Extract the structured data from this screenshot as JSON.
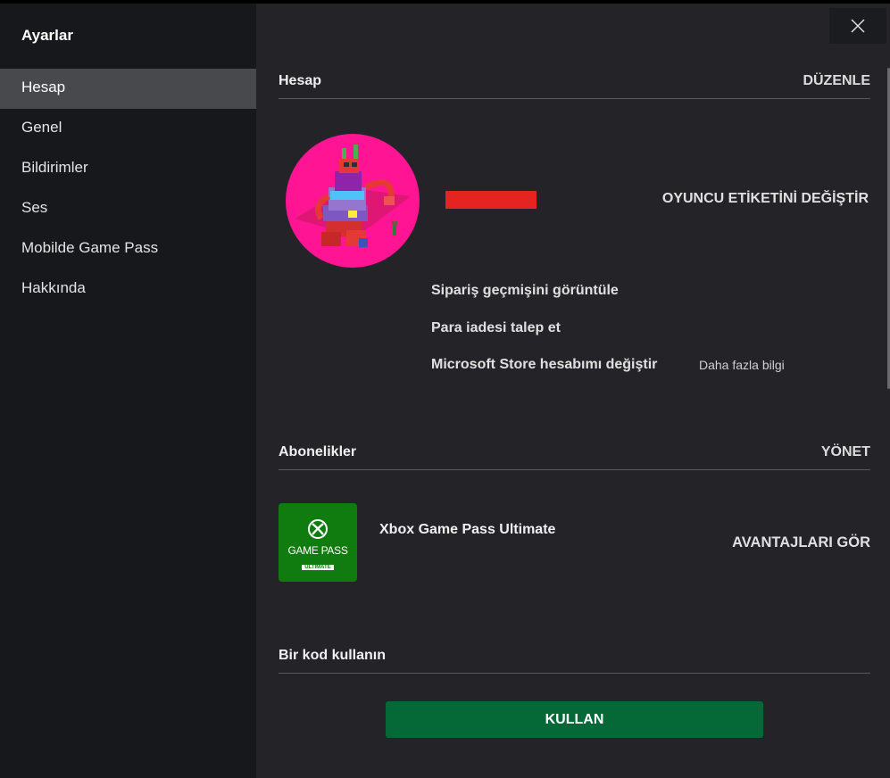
{
  "sidebar": {
    "title": "Ayarlar",
    "items": [
      {
        "label": "Hesap",
        "active": true
      },
      {
        "label": "Genel",
        "active": false
      },
      {
        "label": "Bildirimler",
        "active": false
      },
      {
        "label": "Ses",
        "active": false
      },
      {
        "label": "Mobilde Game Pass",
        "active": false
      },
      {
        "label": "Hakkında",
        "active": false
      }
    ]
  },
  "account": {
    "title": "Hesap",
    "edit_label": "DÜZENLE",
    "change_gamertag_label": "OYUNCU ETİKETİNİ DEĞİŞTİR",
    "links": {
      "order_history": "Sipariş geçmişini görüntüle",
      "refund": "Para iadesi talep et",
      "change_store_account": "Microsoft Store hesabımı değiştir",
      "more_info": "Daha fazla bilgi"
    }
  },
  "subscriptions": {
    "title": "Abonelikler",
    "manage_label": "YÖNET",
    "item": {
      "name": "Xbox Game Pass Ultimate",
      "tile_text": "GAME PASS",
      "tile_badge": "ULTIMATE",
      "benefits_label": "AVANTAJLARI GÖR"
    }
  },
  "redeem": {
    "title": "Bir kod kullanın",
    "button_label": "KULLAN"
  },
  "colors": {
    "accent_green": "#107c10",
    "button_green": "#056937",
    "avatar_bg": "#ff1493",
    "redaction": "#e52320"
  },
  "icons": {
    "close": "close-icon",
    "xbox": "xbox-logo-icon"
  }
}
